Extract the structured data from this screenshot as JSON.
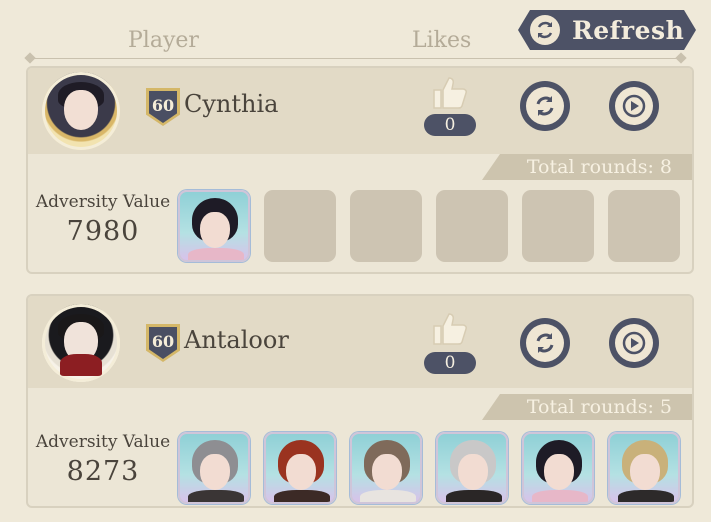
{
  "header": {
    "player_label": "Player",
    "likes_label": "Likes",
    "refresh_label": "Refresh"
  },
  "entries": [
    {
      "name": "Cynthia",
      "level": "60",
      "likes": "0",
      "total_rounds": "Total rounds: 8",
      "adversity_label": "Adversity Value",
      "adversity_value": "7980",
      "slots": [
        {
          "kind": "char",
          "hair": "#1e1b26",
          "body": "#e7b7c8"
        },
        {
          "kind": "empty"
        },
        {
          "kind": "empty"
        },
        {
          "kind": "empty"
        },
        {
          "kind": "empty"
        },
        {
          "kind": "empty"
        }
      ]
    },
    {
      "name": "Antaloor",
      "level": "60",
      "likes": "0",
      "total_rounds": "Total rounds: 5",
      "adversity_label": "Adversity Value",
      "adversity_value": "8273",
      "slots": [
        {
          "kind": "char",
          "hair": "#8e8e92",
          "body": "#3a3535"
        },
        {
          "kind": "char",
          "hair": "#9a3320",
          "body": "#3c2a26"
        },
        {
          "kind": "char",
          "hair": "#7f6a5a",
          "body": "#e8e4e0"
        },
        {
          "kind": "char",
          "hair": "#c9c8c8",
          "body": "#2a2626"
        },
        {
          "kind": "char",
          "hair": "#1e1b26",
          "body": "#e7b7c8"
        },
        {
          "kind": "char",
          "hair": "#c9b17a",
          "body": "#2d2a2a"
        }
      ]
    }
  ],
  "colors": {
    "accent_dark": "#4d5266",
    "gold": "#d4b768",
    "panel": "#e2dac6"
  }
}
